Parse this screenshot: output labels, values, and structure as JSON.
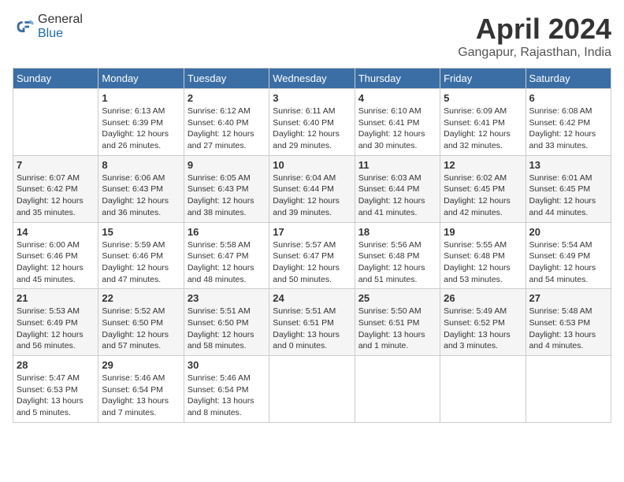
{
  "header": {
    "logo_line1": "General",
    "logo_line2": "Blue",
    "month": "April 2024",
    "location": "Gangapur, Rajasthan, India"
  },
  "columns": [
    "Sunday",
    "Monday",
    "Tuesday",
    "Wednesday",
    "Thursday",
    "Friday",
    "Saturday"
  ],
  "weeks": [
    [
      {
        "day": "",
        "info": ""
      },
      {
        "day": "1",
        "info": "Sunrise: 6:13 AM\nSunset: 6:39 PM\nDaylight: 12 hours\nand 26 minutes."
      },
      {
        "day": "2",
        "info": "Sunrise: 6:12 AM\nSunset: 6:40 PM\nDaylight: 12 hours\nand 27 minutes."
      },
      {
        "day": "3",
        "info": "Sunrise: 6:11 AM\nSunset: 6:40 PM\nDaylight: 12 hours\nand 29 minutes."
      },
      {
        "day": "4",
        "info": "Sunrise: 6:10 AM\nSunset: 6:41 PM\nDaylight: 12 hours\nand 30 minutes."
      },
      {
        "day": "5",
        "info": "Sunrise: 6:09 AM\nSunset: 6:41 PM\nDaylight: 12 hours\nand 32 minutes."
      },
      {
        "day": "6",
        "info": "Sunrise: 6:08 AM\nSunset: 6:42 PM\nDaylight: 12 hours\nand 33 minutes."
      }
    ],
    [
      {
        "day": "7",
        "info": "Sunrise: 6:07 AM\nSunset: 6:42 PM\nDaylight: 12 hours\nand 35 minutes."
      },
      {
        "day": "8",
        "info": "Sunrise: 6:06 AM\nSunset: 6:43 PM\nDaylight: 12 hours\nand 36 minutes."
      },
      {
        "day": "9",
        "info": "Sunrise: 6:05 AM\nSunset: 6:43 PM\nDaylight: 12 hours\nand 38 minutes."
      },
      {
        "day": "10",
        "info": "Sunrise: 6:04 AM\nSunset: 6:44 PM\nDaylight: 12 hours\nand 39 minutes."
      },
      {
        "day": "11",
        "info": "Sunrise: 6:03 AM\nSunset: 6:44 PM\nDaylight: 12 hours\nand 41 minutes."
      },
      {
        "day": "12",
        "info": "Sunrise: 6:02 AM\nSunset: 6:45 PM\nDaylight: 12 hours\nand 42 minutes."
      },
      {
        "day": "13",
        "info": "Sunrise: 6:01 AM\nSunset: 6:45 PM\nDaylight: 12 hours\nand 44 minutes."
      }
    ],
    [
      {
        "day": "14",
        "info": "Sunrise: 6:00 AM\nSunset: 6:46 PM\nDaylight: 12 hours\nand 45 minutes."
      },
      {
        "day": "15",
        "info": "Sunrise: 5:59 AM\nSunset: 6:46 PM\nDaylight: 12 hours\nand 47 minutes."
      },
      {
        "day": "16",
        "info": "Sunrise: 5:58 AM\nSunset: 6:47 PM\nDaylight: 12 hours\nand 48 minutes."
      },
      {
        "day": "17",
        "info": "Sunrise: 5:57 AM\nSunset: 6:47 PM\nDaylight: 12 hours\nand 50 minutes."
      },
      {
        "day": "18",
        "info": "Sunrise: 5:56 AM\nSunset: 6:48 PM\nDaylight: 12 hours\nand 51 minutes."
      },
      {
        "day": "19",
        "info": "Sunrise: 5:55 AM\nSunset: 6:48 PM\nDaylight: 12 hours\nand 53 minutes."
      },
      {
        "day": "20",
        "info": "Sunrise: 5:54 AM\nSunset: 6:49 PM\nDaylight: 12 hours\nand 54 minutes."
      }
    ],
    [
      {
        "day": "21",
        "info": "Sunrise: 5:53 AM\nSunset: 6:49 PM\nDaylight: 12 hours\nand 56 minutes."
      },
      {
        "day": "22",
        "info": "Sunrise: 5:52 AM\nSunset: 6:50 PM\nDaylight: 12 hours\nand 57 minutes."
      },
      {
        "day": "23",
        "info": "Sunrise: 5:51 AM\nSunset: 6:50 PM\nDaylight: 12 hours\nand 58 minutes."
      },
      {
        "day": "24",
        "info": "Sunrise: 5:51 AM\nSunset: 6:51 PM\nDaylight: 13 hours\nand 0 minutes."
      },
      {
        "day": "25",
        "info": "Sunrise: 5:50 AM\nSunset: 6:51 PM\nDaylight: 13 hours\nand 1 minute."
      },
      {
        "day": "26",
        "info": "Sunrise: 5:49 AM\nSunset: 6:52 PM\nDaylight: 13 hours\nand 3 minutes."
      },
      {
        "day": "27",
        "info": "Sunrise: 5:48 AM\nSunset: 6:53 PM\nDaylight: 13 hours\nand 4 minutes."
      }
    ],
    [
      {
        "day": "28",
        "info": "Sunrise: 5:47 AM\nSunset: 6:53 PM\nDaylight: 13 hours\nand 5 minutes."
      },
      {
        "day": "29",
        "info": "Sunrise: 5:46 AM\nSunset: 6:54 PM\nDaylight: 13 hours\nand 7 minutes."
      },
      {
        "day": "30",
        "info": "Sunrise: 5:46 AM\nSunset: 6:54 PM\nDaylight: 13 hours\nand 8 minutes."
      },
      {
        "day": "",
        "info": ""
      },
      {
        "day": "",
        "info": ""
      },
      {
        "day": "",
        "info": ""
      },
      {
        "day": "",
        "info": ""
      }
    ]
  ]
}
